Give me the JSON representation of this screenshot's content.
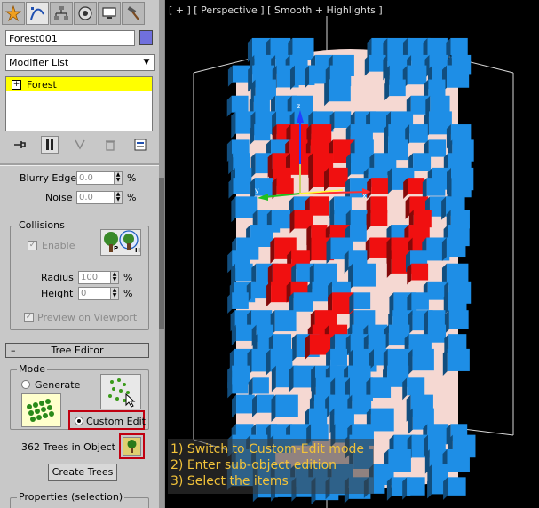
{
  "command_panel": {
    "tabs": [
      {
        "name": "create",
        "icon": "create-star-icon"
      },
      {
        "name": "modify",
        "icon": "modify-curve-icon"
      },
      {
        "name": "hierarchy",
        "icon": "hierarchy-icon"
      },
      {
        "name": "motion",
        "icon": "motion-disc-icon"
      },
      {
        "name": "display",
        "icon": "display-monitor-icon"
      },
      {
        "name": "utilities",
        "icon": "hammer-icon"
      }
    ],
    "object_name": "Forest001",
    "object_color": "#7070dd",
    "modifier_list": "Modifier List",
    "stack_items": [
      "Forest"
    ],
    "stack_expand": "+"
  },
  "spinners": {
    "blurry_edge": {
      "label": "Blurry Edge",
      "value": "0.0",
      "unit": "%"
    },
    "noise": {
      "label": "Noise",
      "value": "0.0",
      "unit": "%"
    }
  },
  "collisions": {
    "title": "Collisions",
    "enable_label": "Enable",
    "radius": {
      "label": "Radius",
      "value": "100",
      "unit": "%"
    },
    "height": {
      "label": "Height",
      "value": "0",
      "unit": "%"
    },
    "preview_label": "Preview on Viewport",
    "button_letters": {
      "top": "P",
      "bottom": "H"
    }
  },
  "tree_editor": {
    "rollout_title": "Tree Editor",
    "rollout_toggle": "–",
    "mode_title": "Mode",
    "generate_label": "Generate",
    "custom_edit_label": "Custom Edit",
    "tree_count_label": "362 Trees in Object",
    "create_trees_label": "Create Trees",
    "properties_label": "Properties (selection)"
  },
  "viewport": {
    "label": "[ + ] [ Perspective ] [ Smooth + Highlights ]",
    "instructions": [
      "1) Switch to Custom-Edit mode",
      "2) Enter sub-object edition",
      "3) Select the items"
    ],
    "colors": {
      "unselected": "#1e8ee6",
      "selected": "#f01010",
      "surface": "#f5d8d2",
      "highlight": "#f2c33a",
      "callout": "#c00010"
    }
  }
}
